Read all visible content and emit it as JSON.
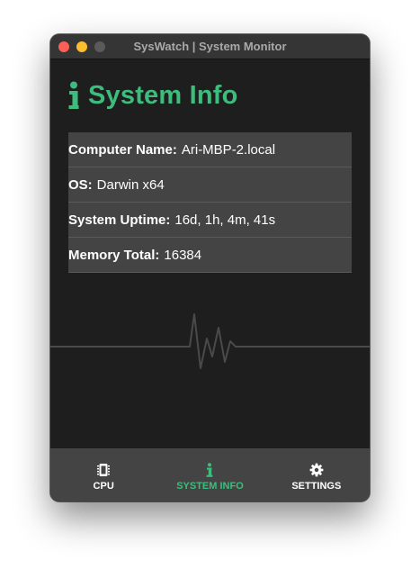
{
  "window": {
    "title": "SysWatch | System Monitor"
  },
  "colors": {
    "accent": "#3dbd7d",
    "background": "#1e1e1e",
    "row": "#444444",
    "tabbar": "#444444"
  },
  "page": {
    "icon": "info-icon",
    "title": "System Info",
    "rows": [
      {
        "label": "Computer Name:",
        "value": "Ari-MBP-2.local"
      },
      {
        "label": "OS:",
        "value": "Darwin x64"
      },
      {
        "label": "System Uptime:",
        "value": "16d, 1h, 4m, 41s"
      },
      {
        "label": "Memory Total:",
        "value": "16384"
      }
    ]
  },
  "tabs": [
    {
      "label": "CPU",
      "icon": "microchip-icon",
      "active": false
    },
    {
      "label": "SYSTEM INFO",
      "icon": "info-icon",
      "active": true
    },
    {
      "label": "SETTINGS",
      "icon": "gear-icon",
      "active": false
    }
  ]
}
